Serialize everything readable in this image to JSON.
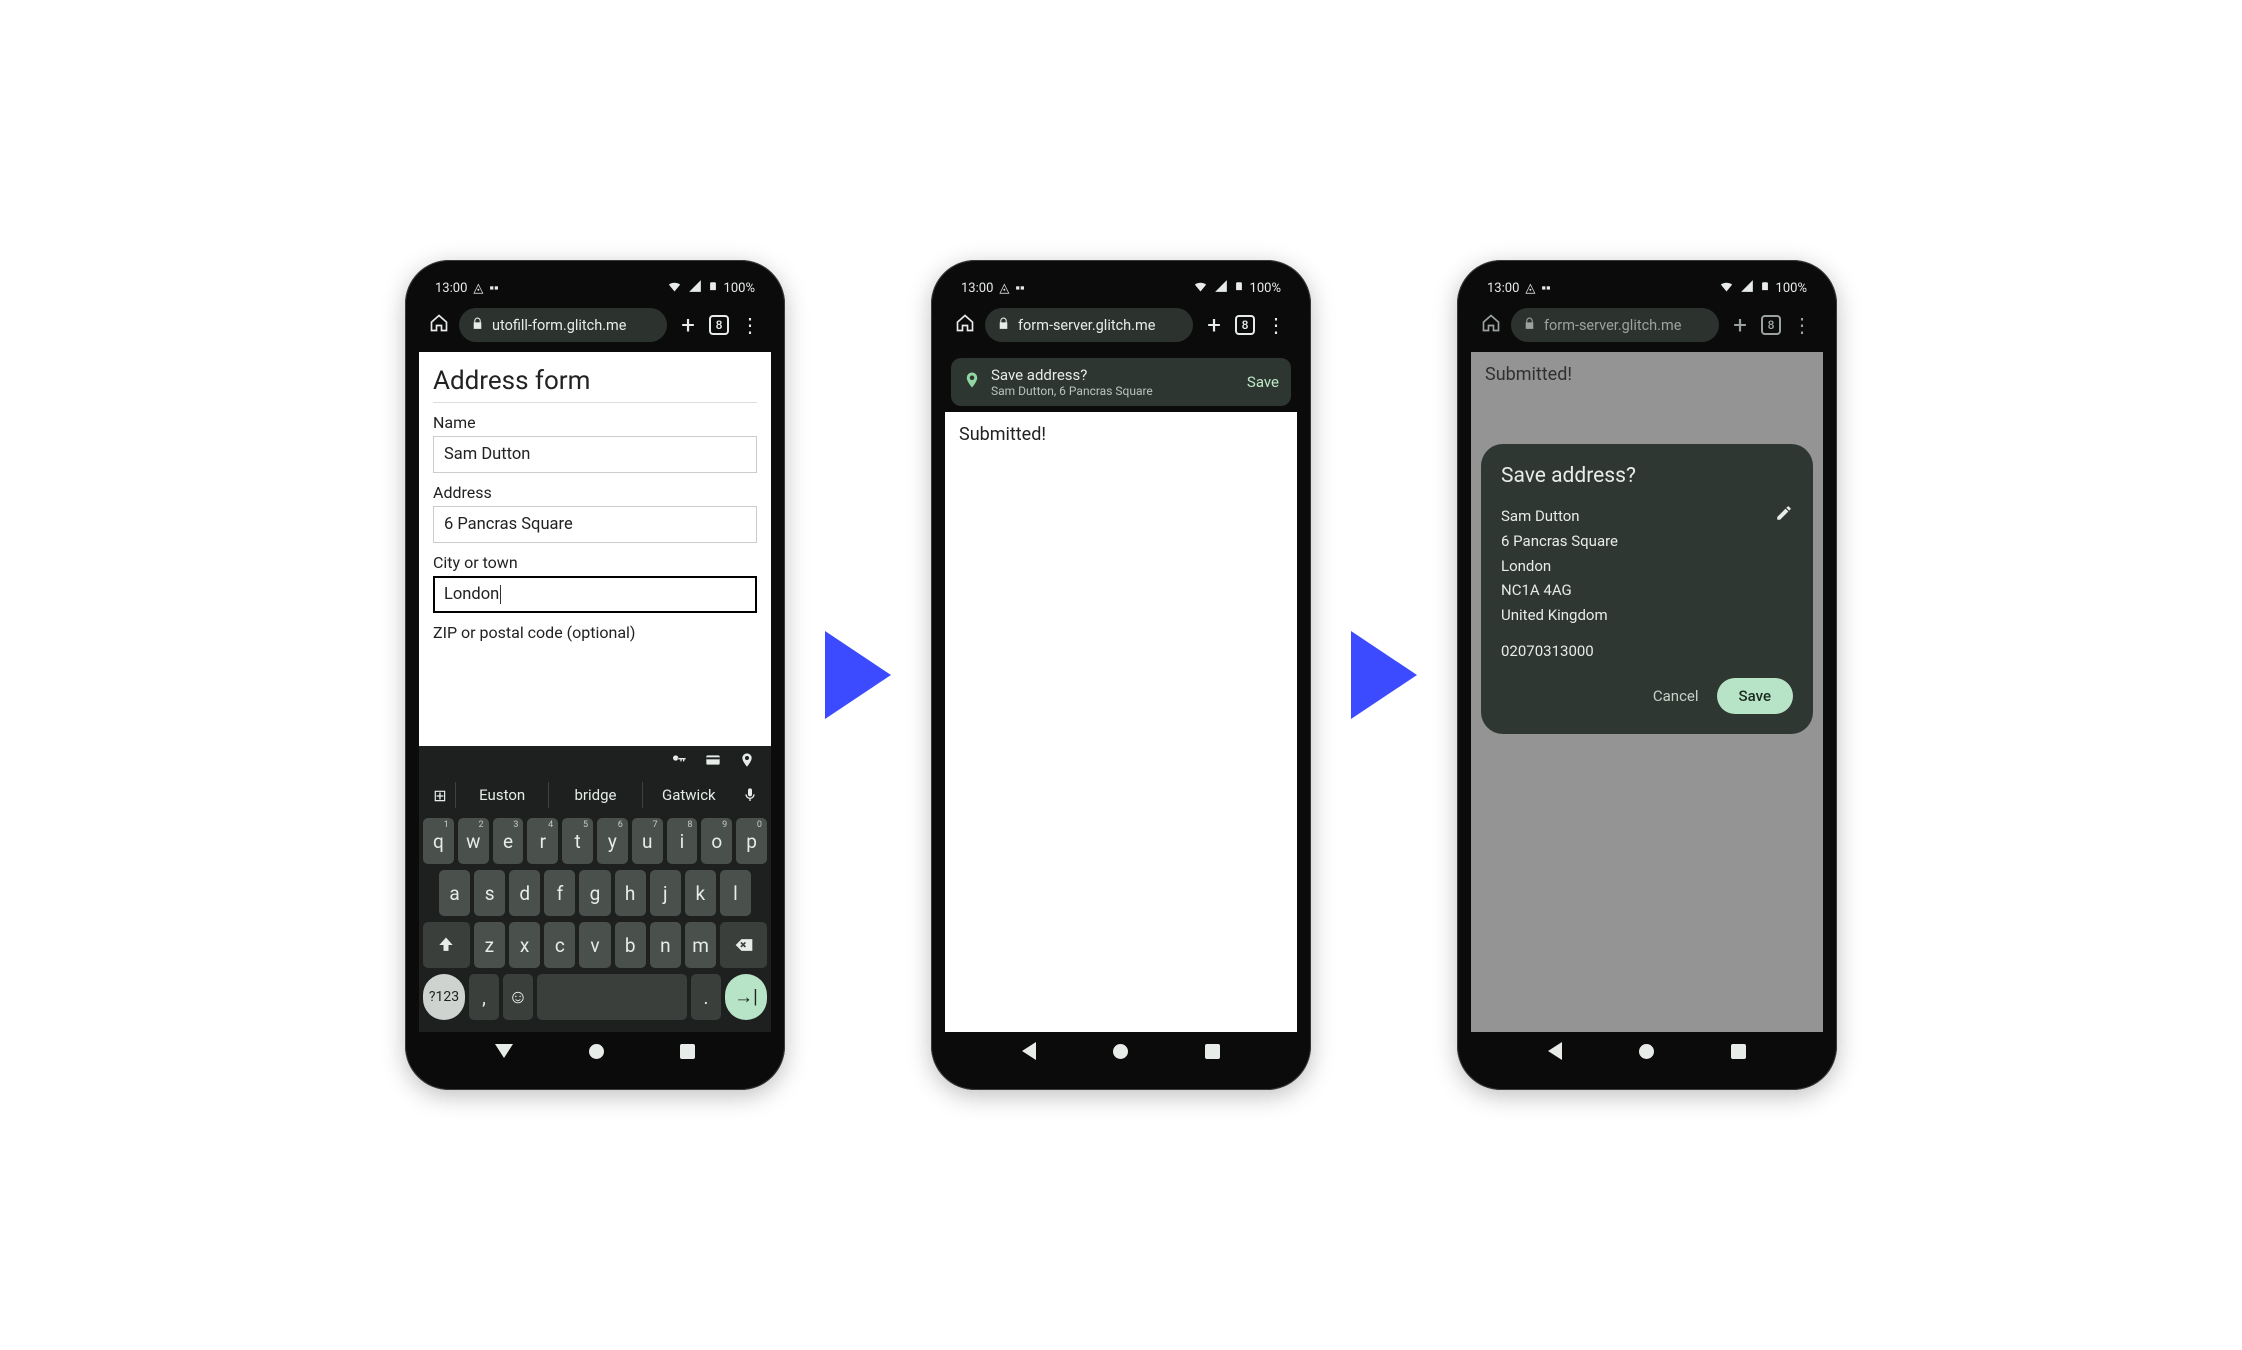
{
  "status": {
    "time": "13:00",
    "battery": "100%"
  },
  "toolbar": {
    "url1": "utofill-form.glitch.me",
    "url2": "form-server.glitch.me",
    "url3": "form-server.glitch.me",
    "tab_count": "8"
  },
  "form": {
    "heading": "Address form",
    "name_label": "Name",
    "name_value": "Sam Dutton",
    "address_label": "Address",
    "address_value": "6 Pancras Square",
    "city_label": "City or town",
    "city_value": "London",
    "zip_label": "ZIP or postal code (optional)"
  },
  "keyboard": {
    "suggestions": [
      "Euston",
      "bridge",
      "Gatwick"
    ],
    "row1": [
      {
        "k": "q",
        "s": "1"
      },
      {
        "k": "w",
        "s": "2"
      },
      {
        "k": "e",
        "s": "3"
      },
      {
        "k": "r",
        "s": "4"
      },
      {
        "k": "t",
        "s": "5"
      },
      {
        "k": "y",
        "s": "6"
      },
      {
        "k": "u",
        "s": "7"
      },
      {
        "k": "i",
        "s": "8"
      },
      {
        "k": "o",
        "s": "9"
      },
      {
        "k": "p",
        "s": "0"
      }
    ],
    "row2": [
      "a",
      "s",
      "d",
      "f",
      "g",
      "h",
      "j",
      "k",
      "l"
    ],
    "row3": [
      "z",
      "x",
      "c",
      "v",
      "b",
      "n",
      "m"
    ],
    "num_key": "?123",
    "comma": ",",
    "period": "."
  },
  "submitted": {
    "text": "Submitted!"
  },
  "save_bar": {
    "title": "Save address?",
    "subtitle": "Sam Dutton, 6 Pancras Square",
    "action": "Save"
  },
  "modal": {
    "title": "Save address?",
    "lines": [
      "Sam Dutton",
      "6 Pancras Square",
      "London",
      "NC1A 4AG",
      "United Kingdom"
    ],
    "phone": "02070313000",
    "cancel": "Cancel",
    "save": "Save"
  }
}
